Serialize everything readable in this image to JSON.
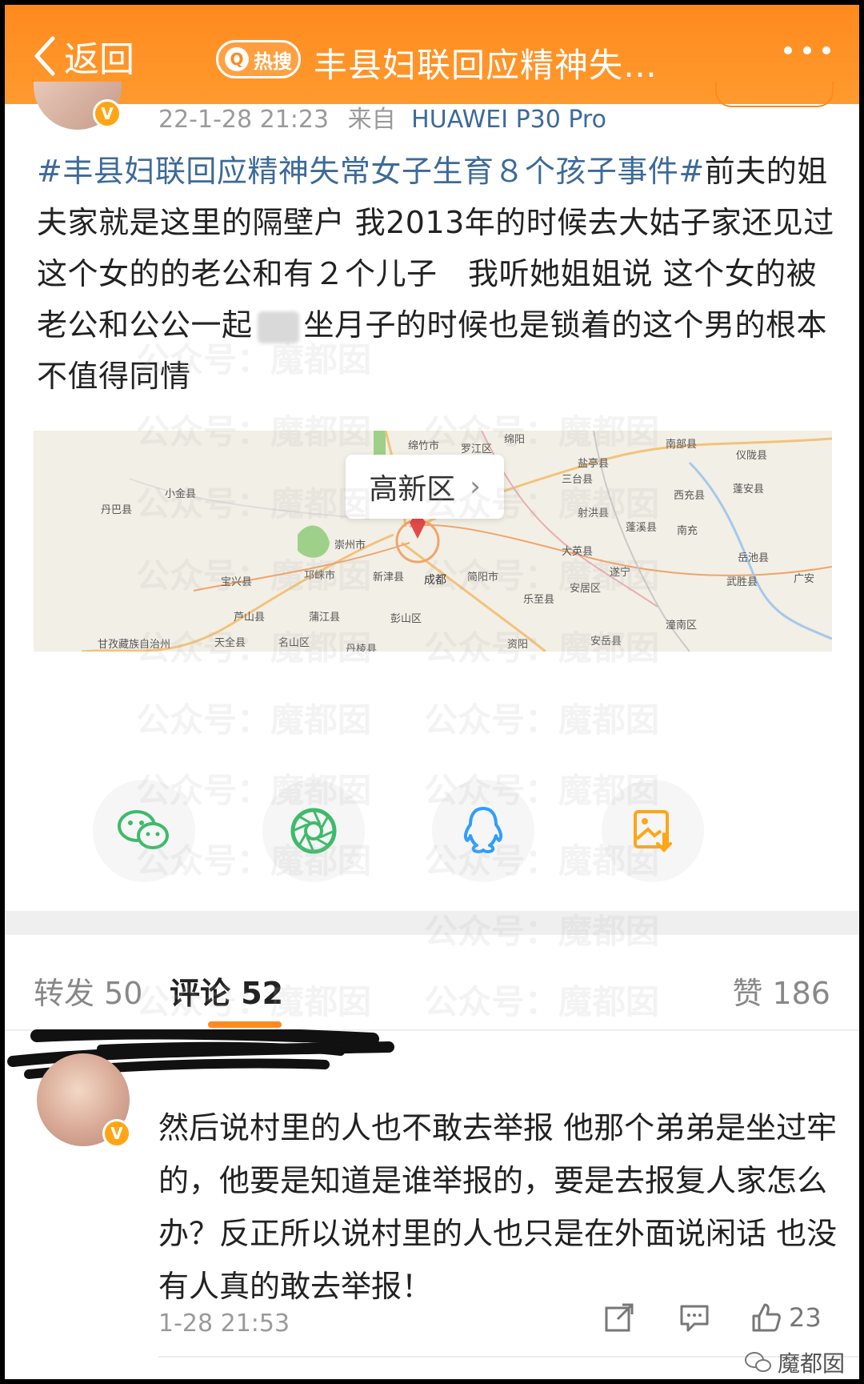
{
  "header": {
    "back_label": "返回",
    "hot_label": "热搜",
    "title": "丰县妇联回应精神失…"
  },
  "post": {
    "meta_time": "22-1-28 21:23",
    "meta_source_prefix": "来自",
    "meta_device": "HUAWEI P30 Pro",
    "hashtag": "#丰县妇联回应精神失常女子生育８个孩子事件#",
    "text_1": "前夫的姐夫家就是这里的隔壁户 我2013年的时候去大姑子家还见过这个女的的老公和有２个儿子　我听她姐姐说 这个女的被老公和公公一起",
    "text_2": "坐月子的时候也是锁着的这个男的根本不值得同情"
  },
  "map": {
    "location_label": "高新区",
    "place_labels": [
      "绵竹市",
      "罗江区",
      "绵阳",
      "盐亭县",
      "南部县",
      "仪陇县",
      "三台县",
      "蓬安县",
      "小金县",
      "西充县",
      "丹巴县",
      "射洪县",
      "南充",
      "蓬溪县",
      "大英县",
      "岳池县",
      "崇州市",
      "遂宁",
      "武胜县",
      "广安",
      "宝兴县",
      "邛崃市",
      "新津县",
      "简阳市",
      "安居区",
      "乐至县",
      "芦山县",
      "蒲江县",
      "彭山区",
      "潼南区",
      "甘孜藏族自治州",
      "天全县",
      "名山区",
      "资阳",
      "丹棱县",
      "安岳县",
      "成都"
    ]
  },
  "share": {
    "icons": [
      "wechat-icon",
      "moments-icon",
      "qq-icon",
      "save-image-icon"
    ]
  },
  "tabs": {
    "repost": "转发 50",
    "comments": "评论 52",
    "likes": "赞 186"
  },
  "comment": {
    "text": "然后说村里的人也不敢去举报 他那个弟弟是坐过牢的，他要是知道是谁举报的，要是去报复人家怎么办？反正所以说村里的人也只是在外面说闲话 也没有人真的敢去举报！",
    "time": "1-28 21:53",
    "like_count": "23"
  },
  "watermark": {
    "text": "公众号：魔都囡",
    "corner": "魔都囡"
  },
  "colors": {
    "header_orange": "#ff8a1e",
    "link_blue": "#3d6a9a",
    "verified_gold": "#ffa516"
  }
}
